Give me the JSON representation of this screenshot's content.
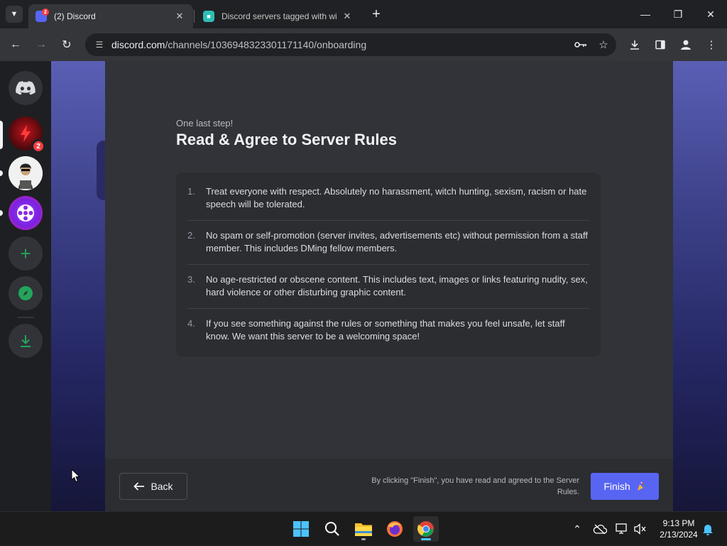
{
  "browser": {
    "tabs": [
      {
        "title": "(2) Discord",
        "favicon_badge": "2",
        "active": true
      },
      {
        "title": "Discord servers tagged with wi",
        "active": false
      }
    ],
    "url_domain": "discord.com",
    "url_path": "/channels/1036948323301171140/onboarding"
  },
  "discord": {
    "guilds": [
      {
        "name": "discord-home"
      },
      {
        "name": "server-red",
        "badge": "2"
      },
      {
        "name": "server-avatar"
      },
      {
        "name": "server-film"
      }
    ],
    "onboarding": {
      "step_label": "One last step!",
      "title": "Read & Agree to Server Rules",
      "rules": [
        {
          "num": "1.",
          "text": "Treat everyone with respect. Absolutely no harassment, witch hunting, sexism, racism or hate speech will be tolerated."
        },
        {
          "num": "2.",
          "text": "No spam or self-promotion (server invites, advertisements etc) without permission from a staff member. This includes DMing fellow members."
        },
        {
          "num": "3.",
          "text": "No age-restricted or obscene content. This includes text, images or links featuring nudity, sex, hard violence or other disturbing graphic content."
        },
        {
          "num": "4.",
          "text": "If you see something against the rules or something that makes you feel unsafe, let staff know. We want this server to be a welcoming space!"
        }
      ],
      "back_label": "Back",
      "finish_note": "By clicking \"Finish\", you have read and agreed to the Server Rules.",
      "finish_label": "Finish"
    }
  },
  "taskbar": {
    "time": "9:13 PM",
    "date": "2/13/2024"
  },
  "colors": {
    "blurple": "#5865f2",
    "discord_bg": "#313338",
    "badge_red": "#f23f43"
  }
}
